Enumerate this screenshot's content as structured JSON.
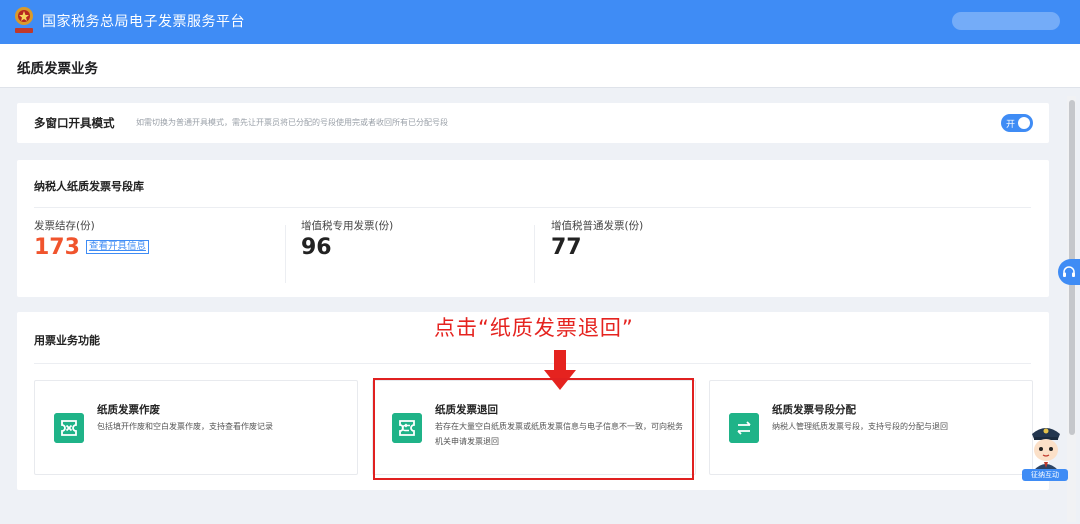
{
  "header": {
    "app_title": "国家税务总局电子发票服务平台",
    "emblem_icon": "tax-emblem-icon"
  },
  "page": {
    "title": "纸质发票业务"
  },
  "multi_window": {
    "label": "多窗口开具模式",
    "hint": "如需切换为普通开具模式，需先让开票员将已分配的号段使用完或者收回所有已分配号段",
    "toggle_text": "开",
    "toggle_on": true
  },
  "pool": {
    "title": "纳税人纸质发票号段库",
    "stats": [
      {
        "label": "发票结存(份)",
        "value": "173",
        "link": "查看开具信息"
      },
      {
        "label": "增值税专用发票(份)",
        "value": "96"
      },
      {
        "label": "增值税普通发票(份)",
        "value": "77"
      }
    ]
  },
  "functions": {
    "title": "用票业务功能",
    "cards": [
      {
        "title": "纸质发票作废",
        "desc": "包括填开作废和空白发票作废，支持查看作废记录",
        "icon": "void-invoice-icon"
      },
      {
        "title": "纸质发票退回",
        "desc": "若存在大量空白纸质发票或纸质发票信息与电子信息不一致，可向税务机关申请发票退回",
        "icon": "return-invoice-icon"
      },
      {
        "title": "纸质发票号段分配",
        "desc": "纳税人管理纸质发票号段，支持号段的分配与退回",
        "icon": "transfer-icon"
      }
    ]
  },
  "annotation": {
    "text": "点击“纸质发票退回”"
  },
  "support": {
    "icon": "headset-icon",
    "mascot_label": "征纳互动"
  },
  "colors": {
    "brand": "#3f8cf5",
    "accent_orange": "#f0542d",
    "icon_green": "#1fb388",
    "annotation_red": "#e5231f"
  }
}
